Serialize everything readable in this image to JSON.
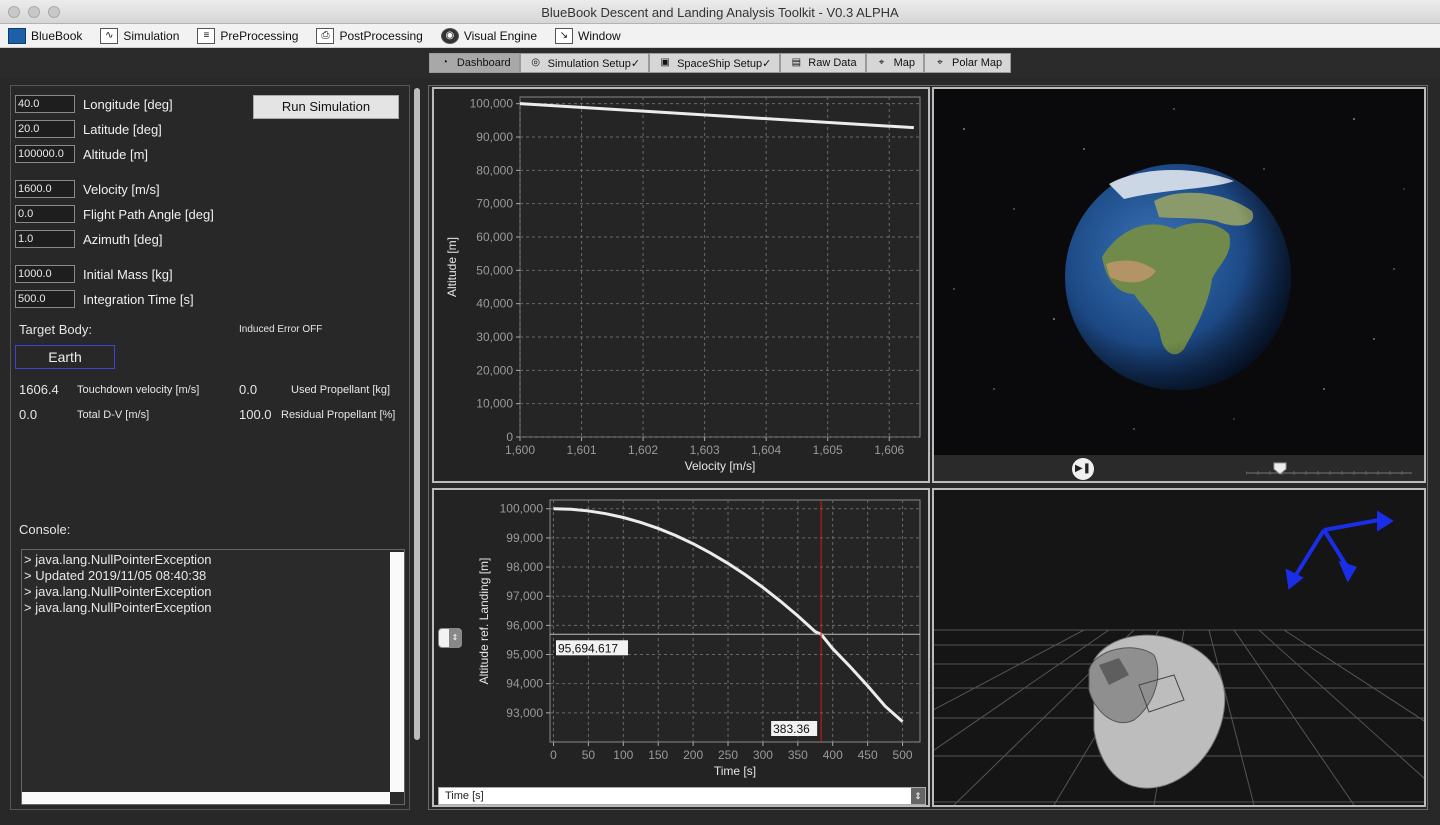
{
  "window": {
    "title": "BlueBook Descent and Landing Analysis Toolkit - V0.3 ALPHA"
  },
  "menu": [
    {
      "label": "BlueBook",
      "icon": "bluebook-logo-icon"
    },
    {
      "label": "Simulation",
      "icon": "simulation-icon"
    },
    {
      "label": "PreProcessing",
      "icon": "preprocessing-icon"
    },
    {
      "label": "PostProcessing",
      "icon": "postprocessing-icon"
    },
    {
      "label": "Visual Engine",
      "icon": "visual-engine-icon"
    },
    {
      "label": "Window",
      "icon": "window-icon"
    }
  ],
  "tabs": [
    {
      "label": "Dashboard",
      "icon": "dashboard-icon",
      "active": true
    },
    {
      "label": "Simulation Setup✓",
      "icon": "simulation-setup-icon"
    },
    {
      "label": "SpaceShip Setup✓",
      "icon": "spaceship-setup-icon"
    },
    {
      "label": "Raw Data",
      "icon": "raw-data-icon"
    },
    {
      "label": "Map",
      "icon": "map-icon"
    },
    {
      "label": "Polar Map",
      "icon": "polar-map-icon"
    }
  ],
  "inputs": {
    "longitude": {
      "value": "40.0",
      "label": "Longitude [deg]"
    },
    "latitude": {
      "value": "20.0",
      "label": "Latitude [deg]"
    },
    "altitude": {
      "value": "100000.0",
      "label": "Altitude [m]"
    },
    "velocity": {
      "value": "1600.0",
      "label": "Velocity [m/s]"
    },
    "fpa": {
      "value": "0.0",
      "label": "Flight Path Angle [deg]"
    },
    "azimuth": {
      "value": "1.0",
      "label": "Azimuth [deg]"
    },
    "mass": {
      "value": "1000.0",
      "label": "Initial Mass [kg]"
    },
    "time": {
      "value": "500.0",
      "label": "Integration Time [s]"
    }
  },
  "run_button": "Run Simulation",
  "target_body_label": "Target Body:",
  "induced_error": "Induced Error OFF",
  "target_body": "Earth",
  "results": {
    "touchdown_velocity": {
      "value": "1606.4",
      "label": "Touchdown velocity [m/s]"
    },
    "used_propellant": {
      "value": "0.0",
      "label": "Used Propellant [kg]"
    },
    "total_dv": {
      "value": "0.0",
      "label": "Total D-V [m/s]"
    },
    "residual_propellant": {
      "value": "100.0",
      "label": "Residual Propellant [%]"
    }
  },
  "console": {
    "label": "Console:",
    "lines": [
      "> java.lang.NullPointerException",
      "> Updated 2019/11/05 08:40:38",
      "> java.lang.NullPointerException",
      "> java.lang.NullPointerException"
    ]
  },
  "bottom_selector": "Time [s]",
  "crosshair": {
    "y_label": "95,694.617",
    "x_label": "383.36"
  },
  "chart_data": [
    {
      "type": "line",
      "xlabel": "Velocity [m/s]",
      "ylabel": "Altitude [m]",
      "xlim": [
        1600,
        1606.5
      ],
      "ylim": [
        0,
        102000
      ],
      "xticks": [
        "1,600",
        "1,601",
        "1,602",
        "1,603",
        "1,604",
        "1,605",
        "1,606"
      ],
      "yticks": [
        "0",
        "10,000",
        "20,000",
        "30,000",
        "40,000",
        "50,000",
        "60,000",
        "70,000",
        "80,000",
        "90,000",
        "100,000"
      ],
      "x": [
        1600.0,
        1606.4
      ],
      "y": [
        100000,
        92800
      ],
      "grid": true
    },
    {
      "type": "line",
      "xlabel": "Time [s]",
      "ylabel": "Altitude ref. Landing [m]",
      "xlim": [
        -5,
        525
      ],
      "ylim": [
        92000,
        100300
      ],
      "xticks": [
        "0",
        "50",
        "100",
        "150",
        "200",
        "250",
        "300",
        "350",
        "400",
        "450",
        "500"
      ],
      "yticks": [
        "93,000",
        "94,000",
        "95,000",
        "96,000",
        "97,000",
        "98,000",
        "99,000",
        "100,000"
      ],
      "x": [
        0,
        25,
        50,
        75,
        100,
        125,
        150,
        175,
        200,
        225,
        250,
        275,
        300,
        325,
        350,
        375,
        383.36,
        400,
        425,
        450,
        475,
        500
      ],
      "y": [
        100000,
        99981,
        99925,
        99831,
        99700,
        99531,
        99325,
        99081,
        98800,
        98481,
        98125,
        97731,
        97300,
        96831,
        96325,
        95781,
        95694.617,
        95200,
        94581,
        93925,
        93231,
        92700
      ],
      "crosshair": {
        "x": 383.36,
        "y": 95694.617
      },
      "grid": true
    }
  ]
}
